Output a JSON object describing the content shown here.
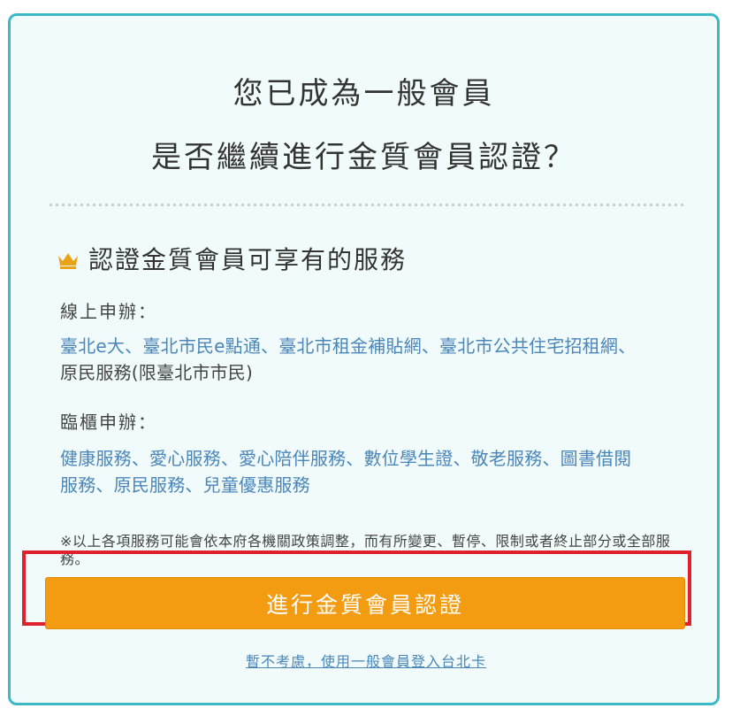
{
  "dialog": {
    "title_line1": "您已成為一般會員",
    "title_line2": "是否繼續進行金質會員認證？",
    "benefits_heading": "認證金質會員可享有的服務",
    "online_label": "線上申辦：",
    "online_services": [
      {
        "text": "臺北e大"
      },
      {
        "text": "臺北市民e點通"
      },
      {
        "text": "臺北市租金補貼網"
      },
      {
        "text": "臺北市公共住宅招租網"
      }
    ],
    "online_services_extra": "原民服務(限臺北市市民)",
    "counter_label": "臨櫃申辦：",
    "counter_services": [
      {
        "text": "健康服務"
      },
      {
        "text": "愛心服務"
      },
      {
        "text": "愛心陪伴服務"
      },
      {
        "text": "數位學生證"
      },
      {
        "text": "敬老服務"
      },
      {
        "text": "圖書借閱"
      },
      {
        "text": "服務"
      },
      {
        "text": "原民服務"
      },
      {
        "text": "兒童優惠服務"
      }
    ],
    "separator": "、",
    "notice": "※以上各項服務可能會依本府各機關政策調整，而有所變更、暫停、限制或者終止部分或全部服務。",
    "cta_label": "進行金質會員認證",
    "skip_label": "暫不考慮，使用一般會員登入台北卡"
  },
  "colors": {
    "border": "#3db8c9",
    "background": "#f2fbfc",
    "link": "#4a86b8",
    "cta": "#f39c12",
    "highlight": "#e0202a",
    "crown": "#e8a317"
  },
  "icons": {
    "crown": "crown-icon"
  }
}
